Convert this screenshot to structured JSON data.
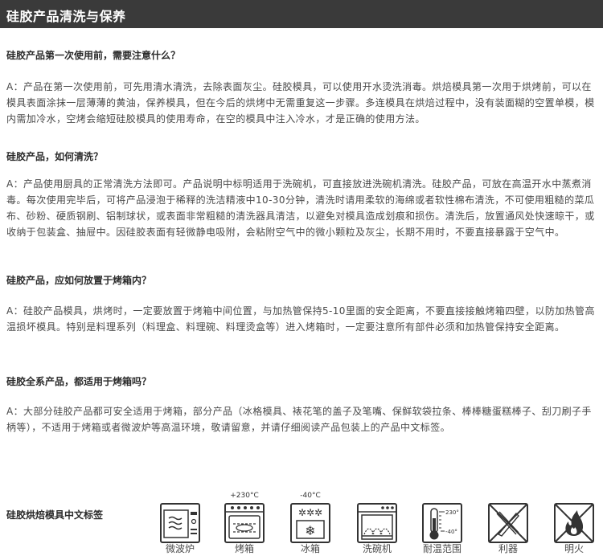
{
  "header": {
    "title": "硅胶产品清洗与保养"
  },
  "faq": [
    {
      "question": "硅胶产品第一次使用前，需要注意什么？",
      "answer": "A：产品在第一次使用前，可先用清水清洗，去除表面灰尘。硅胶模具，可以使用开水烫洗消毒。烘焙模具第一次用于烘烤前，可以在模具表面涂抹一层薄薄的黄油，保养模具，但在今后的烘烤中无需重复这一步骤。多连模具在烘焙过程中，没有装面糊的空置单模，模内需加冷水，空烤会缩短硅胶模具的使用寿命，在空的模具中注入冷水，才是正确的使用方法。"
    },
    {
      "question": "硅胶产品，如何清洗？",
      "answer": "A：产品使用厨具的正常清洗方法即可。产品说明中标明适用于洗碗机，可直接放进洗碗机清洗。硅胶产品，可放在高温开水中蒸煮消毒。每次使用完毕后，可将产品浸泡于稀释的洗洁精液中10-30分钟，清洗时请用柔软的海绵或者软性棉布清洗，不可使用粗糙的菜瓜布、砂粉、硬质钢刷、铝制球状，或表面非常粗糙的清洗器具清洁，以避免对模具造成划痕和损伤。清洗后，放置通风处快速晾干，或收纳于包装盒、抽屉中。因硅胶表面有轻微静电吸附，会粘附空气中的微小颗粒及灰尘，长期不用时，不要直接暴露于空气中。"
    },
    {
      "question": "硅胶产品，应如何放置于烤箱内？",
      "answer": "A：硅胶产品模具，烘烤时，一定要放置于烤箱中间位置，与加热管保持5-10里面的安全距离，不要直接接触烤箱四壁，以防加热管高温损坏模具。特别是料理系列（料理盒、料理碗、料理烫盒等）进入烤箱时，一定要注意所有部件必须和加热管保持安全距离。"
    },
    {
      "question": "硅胶全系产品，都适用于烤箱吗？",
      "answer": "A：大部分硅胶产品都可安全适用于烤箱，部分产品（冰格模具、裱花笔的盖子及笔嘴、保鲜软袋拉条、棒棒糖蛋糕棒子、刮刀刷子手柄等），不适用于烤箱或者微波炉等高温环境，敬请留意，并请仔细阅读产品包装上的产品中文标签。"
    }
  ],
  "labels": {
    "title": "硅胶烘焙模具中文标签",
    "icons": [
      {
        "name": "microwave-icon",
        "caption": "微波炉",
        "temp": ""
      },
      {
        "name": "oven-icon",
        "caption": "烤箱",
        "temp": "+230°C"
      },
      {
        "name": "freezer-icon",
        "caption": "冰箱",
        "temp": "-40°C"
      },
      {
        "name": "dishwasher-icon",
        "caption": "洗碗机",
        "temp": ""
      },
      {
        "name": "thermometer-icon",
        "caption": "耐温范围",
        "temp": "",
        "high": "230°",
        "low": "-40°"
      },
      {
        "name": "no-sharp-tools-icon",
        "caption": "利器",
        "temp": ""
      },
      {
        "name": "no-open-flame-icon",
        "caption": "明火",
        "temp": ""
      }
    ]
  },
  "colors": {
    "header_bg": "#3a3a3a",
    "text": "#4a4a4a",
    "icon_stroke": "#333333"
  }
}
